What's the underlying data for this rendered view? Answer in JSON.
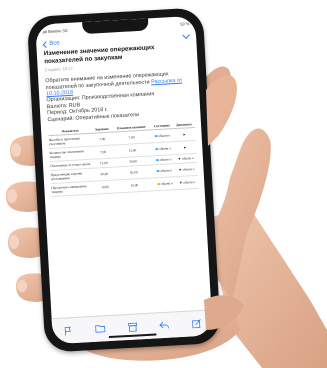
{
  "status": {
    "carrier": ".atl Beeline 3G",
    "time": "16:21",
    "battery": "53 %"
  },
  "nav": {
    "back_label": "Все"
  },
  "mail": {
    "title": "Изменение значение опережающих показателей по закупкам",
    "from": "Создано: 16:17",
    "intro": "Обратите внимание на изменение опережающих показателей по закупочной деятельности",
    "link_text": "Рассылка от 10.10.2018",
    "org": "Организация: Производственная компания",
    "currency": "Валюта: RUB",
    "period": "Период: Октябрь 2018 г.",
    "scenario": "Сценарий: Оперативные показатели"
  },
  "table": {
    "headers": [
      "Показатель",
      "Значение",
      "Плановое значение",
      "Состояние",
      "Динамика"
    ],
    "rows": [
      {
        "name": "Жалобы в претензиях участников",
        "value": "7,00",
        "plan": "7,00",
        "state": "обычн о",
        "trend": "►"
      },
      {
        "name": "Количество отклонения тендера",
        "value": "7,00",
        "plan": "15,00",
        "state": "обычн о",
        "trend": "►"
      },
      {
        "name": "Отклонение от плана заказа",
        "value": "71,00",
        "plan": "50,00",
        "state": "обычн о",
        "trend": "▼ обычн о"
      },
      {
        "name": "Предстоящие закупки поставщиков",
        "value": "30,00",
        "plan": "50,00",
        "state": "обычн о",
        "trend": "▼ обычн о"
      },
      {
        "name": "Просрочено завершения тендера",
        "value": "10,00",
        "plan": "10,00",
        "state": "обычн о",
        "trend": "▼ обычн о"
      }
    ],
    "colors": {
      "state_dot": "#3ab0e6",
      "state_alt": "#f5b400"
    }
  },
  "icons": {
    "back": "chevron-left-icon",
    "flag": "flag-icon",
    "folder": "folder-icon",
    "archive": "archive-icon",
    "reply": "reply-icon",
    "compose": "compose-icon"
  },
  "colors": {
    "accent": "#2f7bf6",
    "phone": "#151515",
    "skin": "#e6b79c"
  }
}
